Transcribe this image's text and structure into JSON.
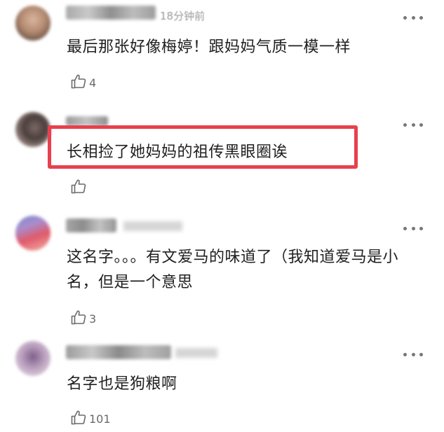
{
  "comments": [
    {
      "time": "18分钟前",
      "text": "最后那张好像梅婷！跟妈妈气质一模一样",
      "likes": "4"
    },
    {
      "time": "",
      "text": "长相捡了她妈妈的祖传黑眼圈诶",
      "likes": ""
    },
    {
      "time": "",
      "text": "这名字。。。有文爱马的味道了（我知道爱马是小名，但是一个意思",
      "likes": "3"
    },
    {
      "time": "",
      "text": "名字也是狗粮啊",
      "likes": "101"
    }
  ],
  "colors": {
    "highlight": "#e8404e",
    "comment_text": "#1f1f1f",
    "meta_text": "#9a9a9a"
  },
  "icons": {
    "like": "thumbs-up-outline-icon",
    "more": "more-horizontal-dots-icon"
  }
}
